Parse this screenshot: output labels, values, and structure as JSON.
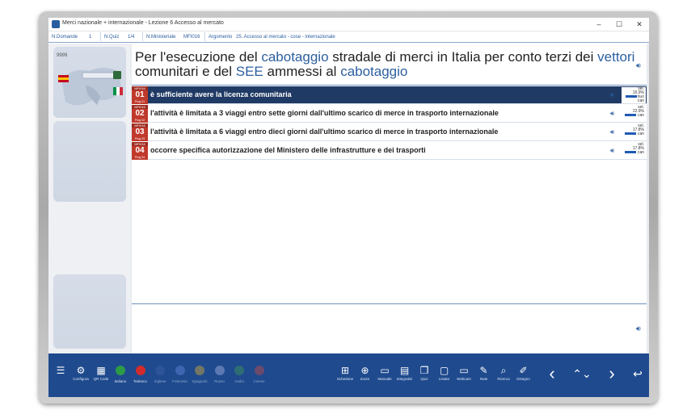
{
  "window": {
    "title": "Merci nazionale + internazionale - Lezione 6 Accesso al mercato",
    "controls": {
      "minimize": "–",
      "maximize": "☐",
      "close": "✕"
    }
  },
  "infobar": {
    "n_domande_label": "N.Domande",
    "n_domande_value": "1",
    "n_quiz_label": "N.Quiz",
    "n_quiz_value": "1/4",
    "n_ministeriale_label": "N.Ministeriale",
    "n_ministeriale_value": "MFI016",
    "argomento_label": "Argomento",
    "argomento_value": "25. Accesso al mercato - cose - internazionale"
  },
  "thumbnail": {
    "id": "9999"
  },
  "question": {
    "parts": [
      {
        "text": "Per l'esecuzione del ",
        "highlight": false
      },
      {
        "text": "cabotaggio",
        "highlight": true
      },
      {
        "text": " stradale di merci in Italia per conto terzi dei ",
        "highlight": false
      },
      {
        "text": "vettori",
        "highlight": true
      },
      {
        "text": " comunitari e del ",
        "highlight": false
      },
      {
        "text": "SEE",
        "highlight": true
      },
      {
        "text": " ammessi al ",
        "highlight": false
      },
      {
        "text": "cabotaggio",
        "highlight": true
      }
    ]
  },
  "answers": [
    {
      "code": "MFI016",
      "num": "01",
      "prog": "Prog 01",
      "text": "è sufficiente avere la licenza comunitaria",
      "selected": true,
      "stat_label": "sel.",
      "stat_pct": "16.9%",
      "stat_extra": "nuo",
      "stat_can": "can"
    },
    {
      "code": "MFI016",
      "num": "02",
      "prog": "Prog 02",
      "text": "l'attività è limitata a 3 viaggi entro sette giorni dall'ultimo scarico di merce in trasporto internazionale",
      "selected": false,
      "stat_label": "sel.",
      "stat_pct": "22.9%",
      "stat_extra": "",
      "stat_can": "can"
    },
    {
      "code": "MFI016",
      "num": "03",
      "prog": "Prog 03",
      "text": "l'attività è limitata a 6 viaggi entro dieci giorni dall'ultimo scarico di merce in trasporto internazionale",
      "selected": false,
      "stat_label": "sel.",
      "stat_pct": "17.8%",
      "stat_extra": "",
      "stat_can": "can"
    },
    {
      "code": "MFI016",
      "num": "04",
      "prog": "Prog 04",
      "text": "occorre specifica autorizzazione del Ministero delle infrastrutture e dei trasporti",
      "selected": false,
      "stat_label": "sel.",
      "stat_pct": "17.8%",
      "stat_extra": "",
      "stat_can": "can"
    }
  ],
  "toolbar": {
    "left": [
      {
        "name": "menu",
        "label": "",
        "icon": "☰"
      },
      {
        "name": "configura",
        "label": "Configura",
        "icon": "⚙"
      },
      {
        "name": "qr-code",
        "label": "QR Code",
        "icon": "▦"
      }
    ],
    "languages": [
      {
        "name": "italiano",
        "label": "Italiano",
        "color": "#2e9b46",
        "dim": false
      },
      {
        "name": "tedesco",
        "label": "Tedesco",
        "color": "#d22b2b",
        "dim": false
      },
      {
        "name": "inglese",
        "label": "Inglese",
        "color": "#3b5ea8",
        "dim": true
      },
      {
        "name": "francese",
        "label": "Francese",
        "color": "#5b7fd1",
        "dim": true
      },
      {
        "name": "spagnolo",
        "label": "Spagnolo",
        "color": "#c8a23a",
        "dim": true
      },
      {
        "name": "russo",
        "label": "Russo",
        "color": "#9aa8d8",
        "dim": true
      },
      {
        "name": "arabo",
        "label": "Arabo",
        "color": "#3f8f5a",
        "dim": true
      },
      {
        "name": "cinese",
        "label": "Cinese",
        "color": "#b84a4a",
        "dim": true
      }
    ],
    "tools": [
      {
        "name": "schedone",
        "label": "Schedone",
        "icon": "⊞"
      },
      {
        "name": "zoom",
        "label": "Zoom",
        "icon": "⊕"
      },
      {
        "name": "manuale",
        "label": "Manuale",
        "icon": "▭"
      },
      {
        "name": "integrativi",
        "label": "Integrativi",
        "icon": "▤"
      },
      {
        "name": "quiz",
        "label": "Quiz",
        "icon": "❐"
      },
      {
        "name": "listato",
        "label": "Listato",
        "icon": "▢"
      },
      {
        "name": "webcam",
        "label": "Webcam",
        "icon": "▭"
      },
      {
        "name": "note",
        "label": "Note",
        "icon": "✎"
      },
      {
        "name": "ricerca",
        "label": "Ricerca",
        "icon": "⌕"
      },
      {
        "name": "disegno",
        "label": "Disegno",
        "icon": "✐"
      }
    ],
    "nav": {
      "prev": "‹",
      "updown": "⌃⌄",
      "next": "›",
      "back": "↩"
    }
  }
}
